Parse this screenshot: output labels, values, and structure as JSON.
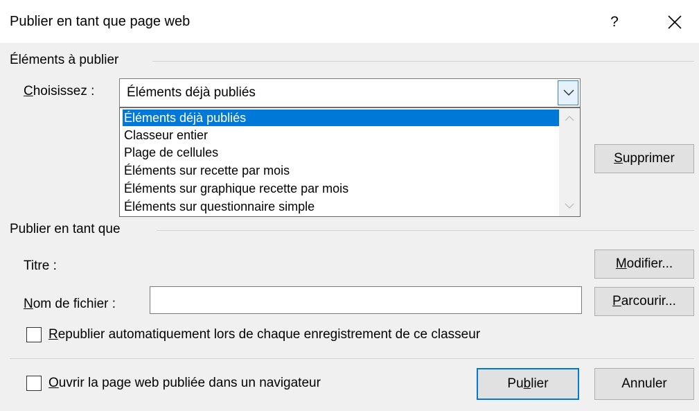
{
  "window": {
    "title": "Publier en tant que page web",
    "help_label": "?",
    "close_icon": "close-icon"
  },
  "items_group": {
    "label": "Éléments à publier",
    "choose_label_accel": "C",
    "choose_label_rest": "hoisissez :",
    "selected": "Éléments déjà publiés",
    "options": [
      "Éléments déjà publiés",
      "Classeur entier",
      "Plage de cellules",
      "Éléments sur recette par mois",
      "Éléments sur graphique recette par mois",
      "Éléments sur questionnaire simple"
    ],
    "delete_accel": "S",
    "delete_rest": "upprimer"
  },
  "publish_as": {
    "label": "Publier en tant que",
    "title_label": "Titre :",
    "modify_accel": "M",
    "modify_rest": "odifier...",
    "filename_accel": "N",
    "filename_rest": "om de fichier :",
    "filename_value": "",
    "browse_accel": "P",
    "browse_rest": "arcourir...",
    "republish_accel": "R",
    "republish_rest": "epublier automatiquement lors de chaque enregistrement de ce classeur",
    "republish_checked": false
  },
  "footer": {
    "open_accel": "O",
    "open_rest": "uvrir la page web publiée dans un navigateur",
    "open_checked": false,
    "publish_pre": "Pu",
    "publish_accel": "b",
    "publish_post": "lier",
    "cancel_label": "Annuler"
  },
  "colors": {
    "selection": "#0078d7",
    "dialog_bg": "#f0f0f0",
    "button_bg": "#e1e1e1"
  }
}
